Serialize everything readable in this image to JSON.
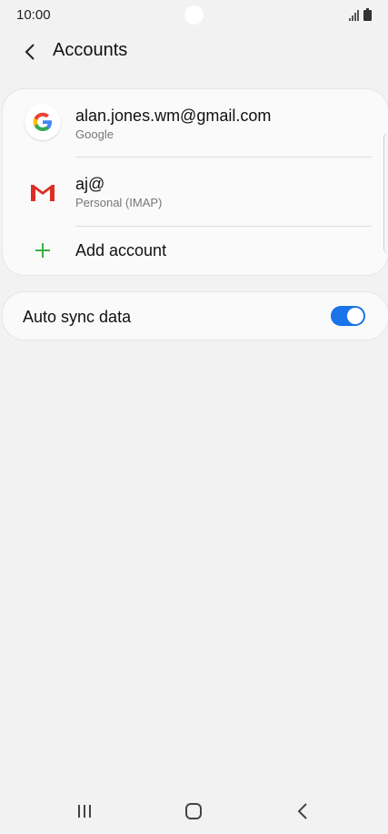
{
  "status": {
    "time": "10:00"
  },
  "header": {
    "title": "Accounts"
  },
  "accounts": [
    {
      "name": "alan.jones.wm@gmail.com",
      "type": "Google",
      "icon": "google-icon"
    },
    {
      "name": "aj@",
      "type": "Personal (IMAP)",
      "icon": "gmail-icon"
    }
  ],
  "add_account": {
    "label": "Add account",
    "icon": "plus-icon",
    "accent": "#3cb043"
  },
  "sync": {
    "label": "Auto sync data",
    "enabled": true,
    "toggle_color": "#1a73e8"
  },
  "nav": {
    "icons": [
      "recent-apps-icon",
      "home-icon",
      "back-icon"
    ]
  }
}
